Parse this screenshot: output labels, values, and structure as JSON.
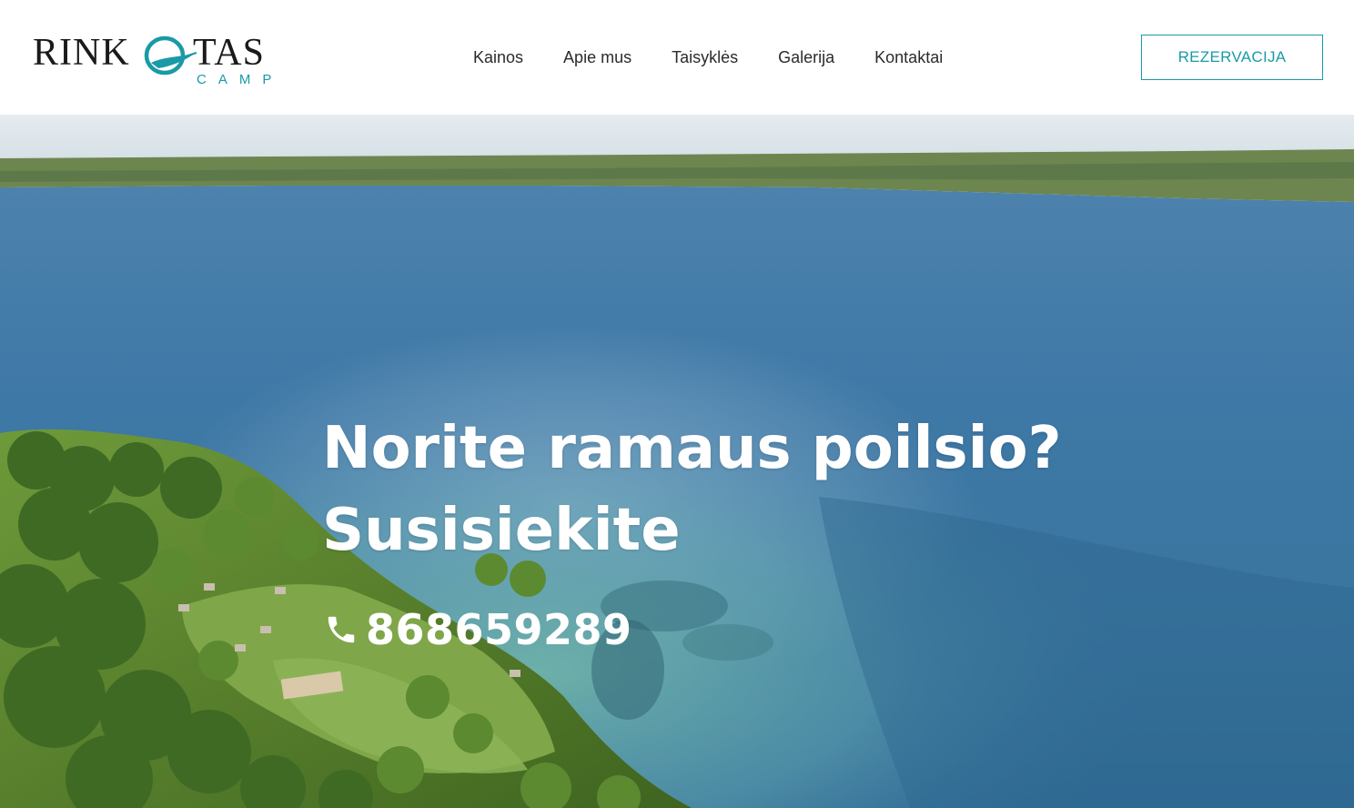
{
  "brand": {
    "name_left": "RINK",
    "name_right": "TAS",
    "subtitle": "CAMP",
    "accent_color": "#1a9aa6"
  },
  "nav": {
    "items": [
      {
        "label": "Kainos"
      },
      {
        "label": "Apie mus"
      },
      {
        "label": "Taisyklės"
      },
      {
        "label": "Galerija"
      },
      {
        "label": "Kontaktai"
      }
    ],
    "reserve_label": "REZERVACIJA"
  },
  "hero": {
    "heading_line1": "Norite ramaus poilsio?",
    "heading_line2": "Susisiekite",
    "phone": "868659289",
    "phone_icon": "phone-icon",
    "background": "aerial lake photo"
  }
}
